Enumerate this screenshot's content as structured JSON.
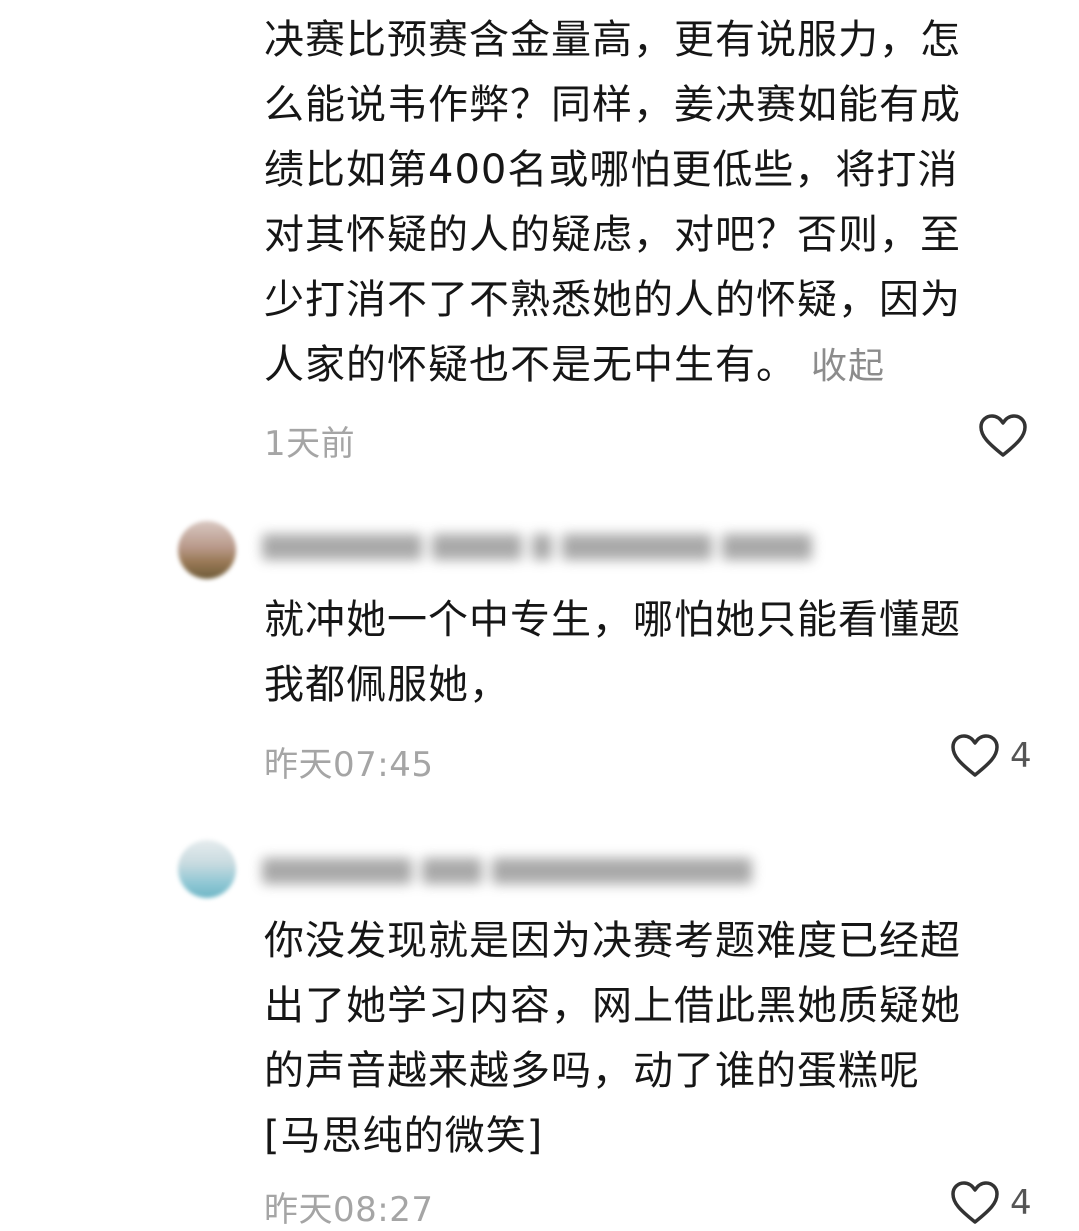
{
  "comments": [
    {
      "lines": [
        "决赛比预赛含金量高，更有说服力，怎",
        "么能说韦作弊？同样，姜决赛如能有成",
        "绩比如第400名或哪怕更低些，将打消",
        "对其怀疑的人的疑虑，对吧？否则，至",
        "少打消不了不熟悉她的人的怀疑，因为",
        "人家的怀疑也不是无中生有。"
      ],
      "collapse_label": "收起",
      "time": "1天前",
      "likes": ""
    },
    {
      "lines": [
        "就冲她一个中专生，哪怕她只能看懂题",
        "我都佩服她，"
      ],
      "time": "昨天07:45",
      "likes": "4"
    },
    {
      "lines": [
        "你没发现就是因为决赛考题难度已经超",
        "出了她学习内容，网上借此黑她质疑她",
        "的声音越来越多吗，动了谁的蛋糕呢",
        "[马思纯的微笑]"
      ],
      "time": "昨天08:27",
      "likes": "4"
    }
  ],
  "icons": {
    "like": "heart-outline-icon"
  },
  "colors": {
    "text": "#161616",
    "meta": "#a5a5a5",
    "collapse": "#8c8c8c",
    "heart": "#333333"
  }
}
